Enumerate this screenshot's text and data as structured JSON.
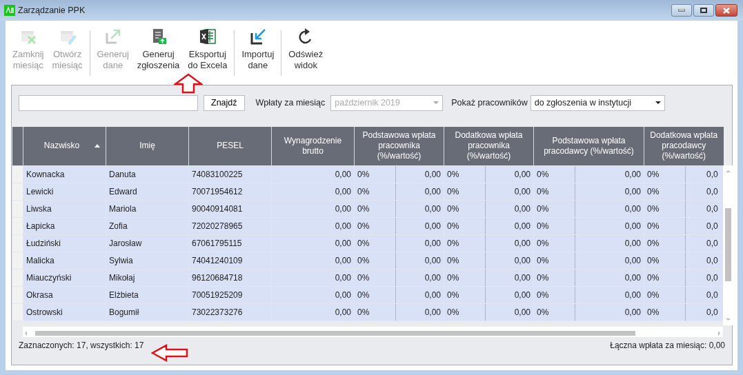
{
  "window": {
    "title": "Zarządzanie PPK"
  },
  "toolbar": [
    {
      "kind": "close-month",
      "label": "Zamknij\nmiesiąc",
      "disabled": true
    },
    {
      "kind": "open-month",
      "label": "Otwórz\nmiesiąc",
      "disabled": true
    },
    {
      "kind": "generate-data",
      "label": "Generuj\ndane",
      "disabled": true
    },
    {
      "kind": "generate-reports",
      "label": "Generuj\nzgłoszenia",
      "disabled": false
    },
    {
      "kind": "excel",
      "label": "Eksportuj\ndo Excela",
      "disabled": false
    },
    {
      "kind": "import",
      "label": "Importuj\ndane",
      "disabled": false
    },
    {
      "kind": "refresh",
      "label": "Odśwież\nwidok",
      "disabled": false
    }
  ],
  "filter": {
    "search_button": "Znajdź",
    "month_label": "Wpłaty za miesiąc",
    "month_value": "październik 2019",
    "month_disabled": true,
    "show_label": "Pokaż pracowników",
    "show_value": "do zgłoszenia w instytucji"
  },
  "table": {
    "columns": [
      "Nazwisko",
      "Imię",
      "PESEL",
      "Wynagrodzenie brutto",
      "Podstawowa wpłata pracownika (%/wartość)",
      "Dodatkowa wpłata pracownika (%/wartość)",
      "Podstawowa wpłata pracodawcy (%/wartość)",
      "Dodatkowa wpłata pracodawcy (%/wartość)"
    ],
    "rows": [
      {
        "cells": [
          "Kownacka",
          "Danuta",
          "74083100225",
          "0,00"
        ],
        "contributions": [
          {
            "percent": "0%",
            "value": "0,00"
          },
          {
            "percent": "0%",
            "value": "0,00"
          },
          {
            "percent": "0%",
            "value": "0,00"
          },
          {
            "percent": "0%",
            "value": "0,0"
          }
        ],
        "selected": true
      },
      {
        "cells": [
          "Lewicki",
          "Edward",
          "70071954612",
          "0,00"
        ],
        "contributions": [
          {
            "percent": "0%",
            "value": "0,00"
          },
          {
            "percent": "0%",
            "value": "0,00"
          },
          {
            "percent": "0%",
            "value": "0,00"
          },
          {
            "percent": "0%",
            "value": "0,0"
          }
        ],
        "selected": true
      },
      {
        "cells": [
          "Liwska",
          "Mariola",
          "90040914081",
          "0,00"
        ],
        "contributions": [
          {
            "percent": "0%",
            "value": "0,00"
          },
          {
            "percent": "0%",
            "value": "0,00"
          },
          {
            "percent": "0%",
            "value": "0,00"
          },
          {
            "percent": "0%",
            "value": "0,0"
          }
        ],
        "selected": true
      },
      {
        "cells": [
          "Łapicka",
          "Zofia",
          "72020278965",
          "0,00"
        ],
        "contributions": [
          {
            "percent": "0%",
            "value": "0,00"
          },
          {
            "percent": "0%",
            "value": "0,00"
          },
          {
            "percent": "0%",
            "value": "0,00"
          },
          {
            "percent": "0%",
            "value": "0,0"
          }
        ],
        "selected": true
      },
      {
        "cells": [
          "Łudziński",
          "Jarosław",
          "67061795115",
          "0,00"
        ],
        "contributions": [
          {
            "percent": "0%",
            "value": "0,00"
          },
          {
            "percent": "0%",
            "value": "0,00"
          },
          {
            "percent": "0%",
            "value": "0,00"
          },
          {
            "percent": "0%",
            "value": "0,0"
          }
        ],
        "selected": true
      },
      {
        "cells": [
          "Malicka",
          "Sylwia",
          "74041240109",
          "0,00"
        ],
        "contributions": [
          {
            "percent": "0%",
            "value": "0,00"
          },
          {
            "percent": "0%",
            "value": "0,00"
          },
          {
            "percent": "0%",
            "value": "0,00"
          },
          {
            "percent": "0%",
            "value": "0,0"
          }
        ],
        "selected": true
      },
      {
        "cells": [
          "Miauczyński",
          "Mikołaj",
          "96120684718",
          "0,00"
        ],
        "contributions": [
          {
            "percent": "0%",
            "value": "0,00"
          },
          {
            "percent": "0%",
            "value": "0,00"
          },
          {
            "percent": "0%",
            "value": "0,00"
          },
          {
            "percent": "0%",
            "value": "0,0"
          }
        ],
        "selected": true
      },
      {
        "cells": [
          "Okrasa",
          "Elżbieta",
          "70051925209",
          "0,00"
        ],
        "contributions": [
          {
            "percent": "0%",
            "value": "0,00"
          },
          {
            "percent": "0%",
            "value": "0,00"
          },
          {
            "percent": "0%",
            "value": "0,00"
          },
          {
            "percent": "0%",
            "value": "0,0"
          }
        ],
        "selected": true
      },
      {
        "cells": [
          "Ostrowski",
          "Bogumił",
          "73022373276",
          "0,00"
        ],
        "contributions": [
          {
            "percent": "0%",
            "value": "0,00"
          },
          {
            "percent": "0%",
            "value": "0,00"
          },
          {
            "percent": "0%",
            "value": "0,00"
          },
          {
            "percent": "0%",
            "value": "0,0"
          }
        ],
        "selected": true
      }
    ]
  },
  "status_bar": {
    "left": "Zaznaczonych: 17, wszystkich: 17",
    "right": "Łączna wpłata za miesiąc: 0,00"
  }
}
